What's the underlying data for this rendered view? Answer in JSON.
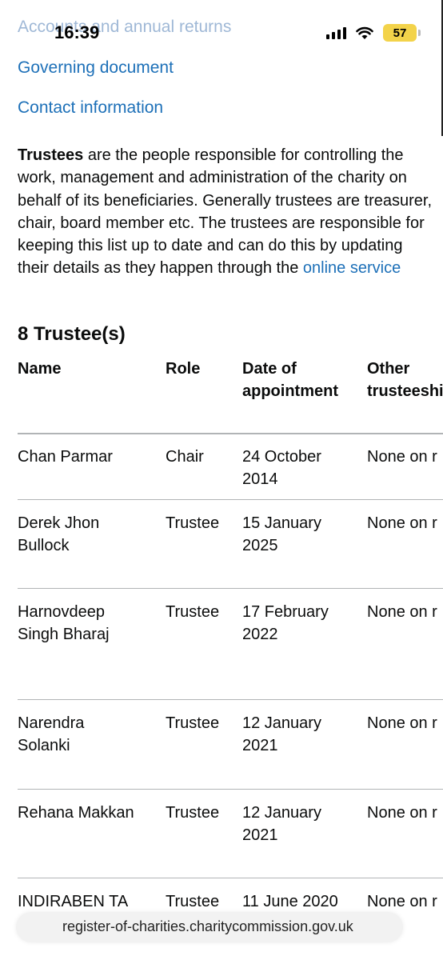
{
  "status_bar": {
    "time": "16:39",
    "battery": "57"
  },
  "nav_links": [
    "Accounts and annual returns",
    "Governing document",
    "Contact information"
  ],
  "intro": {
    "bold_term": "Trustees",
    "text": " are the people responsible for controlling the work, management and administration of the charity on behalf of its beneficiaries. Generally trustees are treasurer, chair, board member etc. The trustees are responsible for keeping this list up to date and can do this by updating their details as they happen through the ",
    "link_text": "online service"
  },
  "trustees": {
    "heading": "8 Trustee(s)",
    "columns": [
      "Name",
      "Role",
      "Date of appointment",
      "Other trusteeships"
    ],
    "rows": [
      {
        "name": "Chan Parmar",
        "role": "Chair",
        "date": "24 October 2014",
        "other": "None on r"
      },
      {
        "name": "Derek Jhon Bullock",
        "role": "Trustee",
        "date": "15 January 2025",
        "other": "None on r"
      },
      {
        "name": "Harnovdeep Singh Bharaj",
        "role": "Trustee",
        "date": "17 February 2022",
        "other": "None on r"
      },
      {
        "name": "Narendra Solanki",
        "role": "Trustee",
        "date": "12 January 2021",
        "other": "None on r"
      },
      {
        "name": "Rehana Makkan",
        "role": "Trustee",
        "date": "12 January 2021",
        "other": "None on r"
      },
      {
        "name": "INDIRABEN TA",
        "role": "Trustee",
        "date": "11 June 2020",
        "other": "None on r"
      }
    ]
  },
  "url_bar": {
    "url": "register-of-charities.charitycommission.gov.uk"
  }
}
